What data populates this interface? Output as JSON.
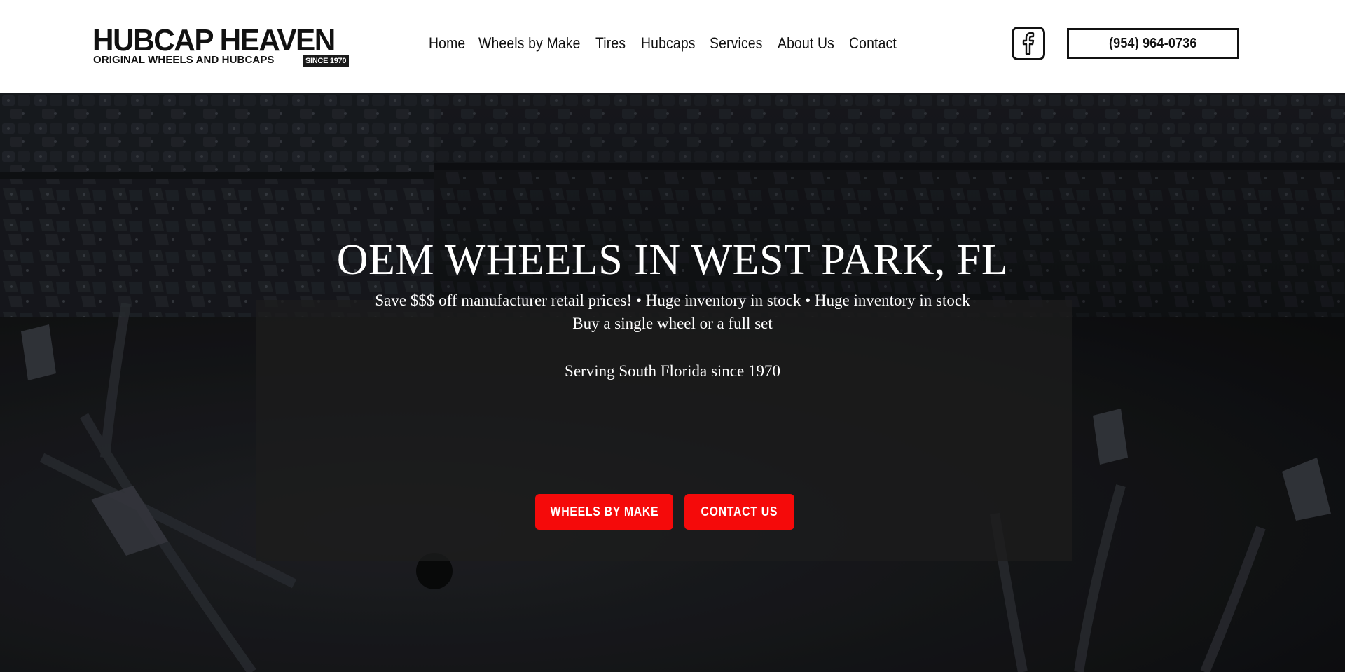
{
  "brand": {
    "name": "HUBCAP HEAVEN",
    "tagline": "ORIGINAL WHEELS AND HUBCAPS",
    "since": "SINCE 1970"
  },
  "nav": {
    "items": [
      {
        "label": "Home"
      },
      {
        "label": "Wheels by Make"
      },
      {
        "label": "Tires"
      },
      {
        "label": "Hubcaps"
      },
      {
        "label": "Services"
      },
      {
        "label": "About Us"
      },
      {
        "label": "Contact"
      }
    ]
  },
  "header": {
    "social_icon": "facebook-icon",
    "phone": "(954) 964-0736"
  },
  "hero": {
    "title": "OEM WHEELS IN WEST PARK, FL",
    "line1": "Save $$$ off manufacturer retail prices! • Huge inventory in stock • Huge inventory in stock",
    "line2": "Buy a single wheel or a full set",
    "line3": "Serving South Florida since 1970",
    "buttons": {
      "wheels": "WHEELS BY MAKE",
      "contact": "CONTACT US"
    }
  },
  "colors": {
    "accent": "#f50a0a",
    "text_dark": "#111111",
    "panel": "#1c1c1c"
  }
}
